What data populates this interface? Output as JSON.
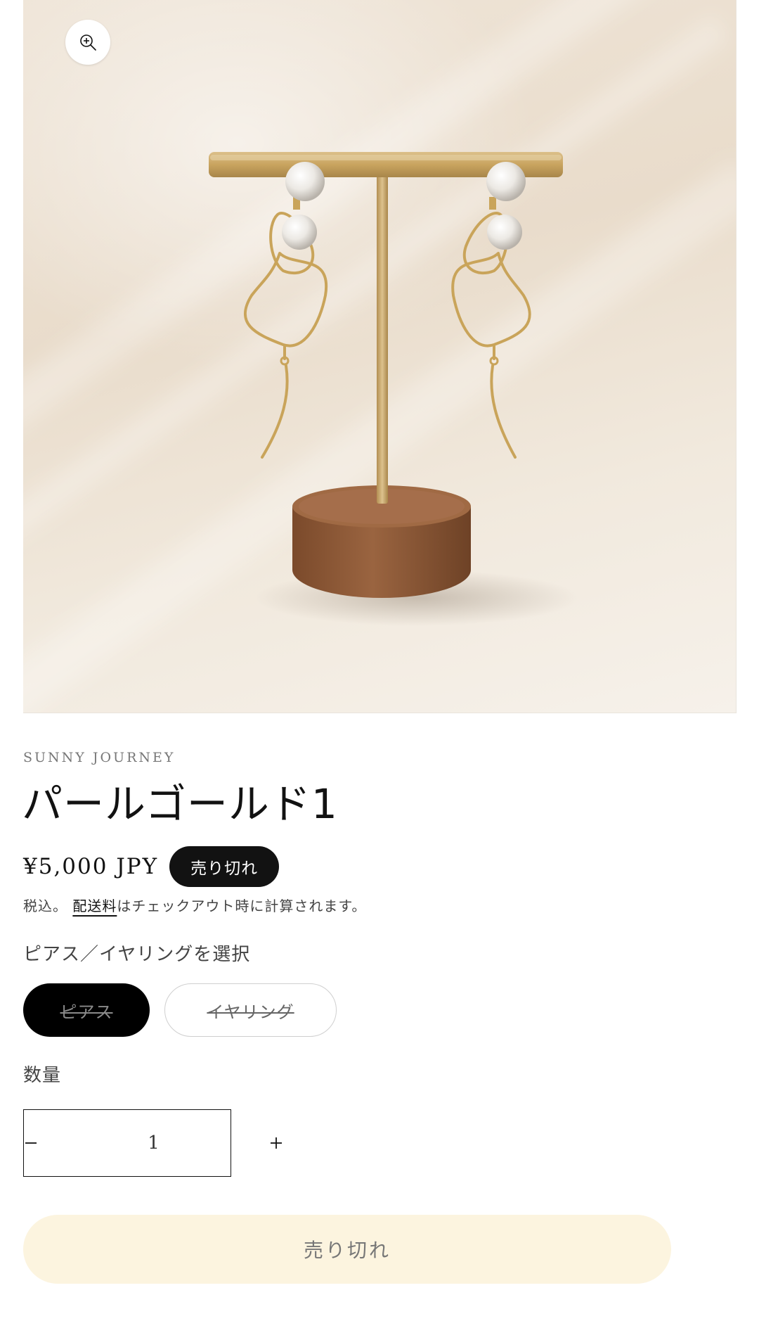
{
  "product": {
    "vendor": "SUNNY JOURNEY",
    "title": "パールゴールド1",
    "price": "¥5,000 JPY",
    "badge": "売り切れ",
    "tax_prefix": "税込。",
    "shipping_link": "配送料",
    "tax_suffix": "はチェックアウト時に計算されます。",
    "image_alt": "パールゴールド1"
  },
  "variant": {
    "label": "ピアス／イヤリングを選択",
    "options": [
      {
        "label": "ピアス",
        "selected": true,
        "available": false
      },
      {
        "label": "イヤリング",
        "selected": false,
        "available": false
      }
    ]
  },
  "quantity": {
    "label": "数量",
    "value": "1"
  },
  "actions": {
    "add_to_cart_label": "売り切れ"
  },
  "colors": {
    "text": "#121212",
    "badge_bg": "#121212",
    "button_bg": "#fcf4df",
    "gold": "#c9a45a",
    "wood": "#8a5633"
  },
  "icons": {
    "zoom": "zoom-in-icon",
    "minus": "minus-icon",
    "plus": "plus-icon"
  }
}
